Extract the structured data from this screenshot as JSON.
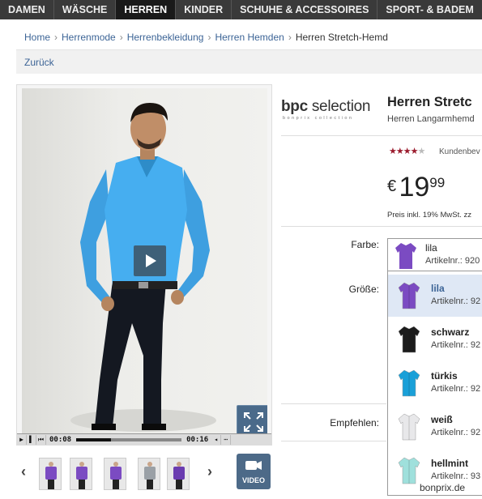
{
  "nav": {
    "items": [
      "DAMEN",
      "WÄSCHE",
      "HERREN",
      "KINDER",
      "SCHUHE & ACCESSOIRES",
      "SPORT- & BADEM"
    ],
    "active_index": 2
  },
  "breadcrumb": {
    "items": [
      "Home",
      "Herrenmode",
      "Herrenbekleidung",
      "Herren Hemden"
    ],
    "current": "Herren Stretch-Hemd"
  },
  "back_link": "Zurück",
  "video": {
    "current_time": "00:08",
    "total_time": "00:16",
    "progress": 0.33,
    "video_button_label": "VIDEO"
  },
  "thumbnails": [
    {
      "shirt_color": "#7b4bc2"
    },
    {
      "shirt_color": "#7b4bc2"
    },
    {
      "shirt_color": "#7b4bc2"
    },
    {
      "shirt_color": "#9aa0a6"
    },
    {
      "shirt_color": "#6a3cb0"
    }
  ],
  "product": {
    "brand": "bpc selection",
    "brand_sub": "bonprix collection",
    "title": "Herren Stretc",
    "subtitle": "Herren Langarmhemd",
    "rating_stars": "★★★★★",
    "rating_value": 4,
    "reviews_label": "Kundenbev",
    "price_currency": "€",
    "price_euros": "19",
    "price_cents": "99",
    "price_note": "Preis inkl. 19% MwSt. zz"
  },
  "labels": {
    "color": "Farbe:",
    "size": "Größe:",
    "recommend": "Empfehlen:"
  },
  "color_select": {
    "name": "lila",
    "article": "Artikelnr.: 920",
    "swatch": "#7b4bc2"
  },
  "color_options": [
    {
      "name": "lila",
      "article": "Artikelnr.: 92",
      "swatch": "#7b4bc2",
      "selected": true
    },
    {
      "name": "schwarz",
      "article": "Artikelnr.: 92",
      "swatch": "#1c1c1c",
      "selected": false
    },
    {
      "name": "türkis",
      "article": "Artikelnr.: 92",
      "swatch": "#1aa0d8",
      "selected": false
    },
    {
      "name": "weiß",
      "article": "Artikelnr.: 92",
      "swatch": "#e8e8ea",
      "selected": false
    },
    {
      "name": "hellmint",
      "article": "Artikelnr.: 93",
      "swatch": "#9fe0dc",
      "selected": false
    }
  ],
  "footer_brand": "bonprix.de"
}
